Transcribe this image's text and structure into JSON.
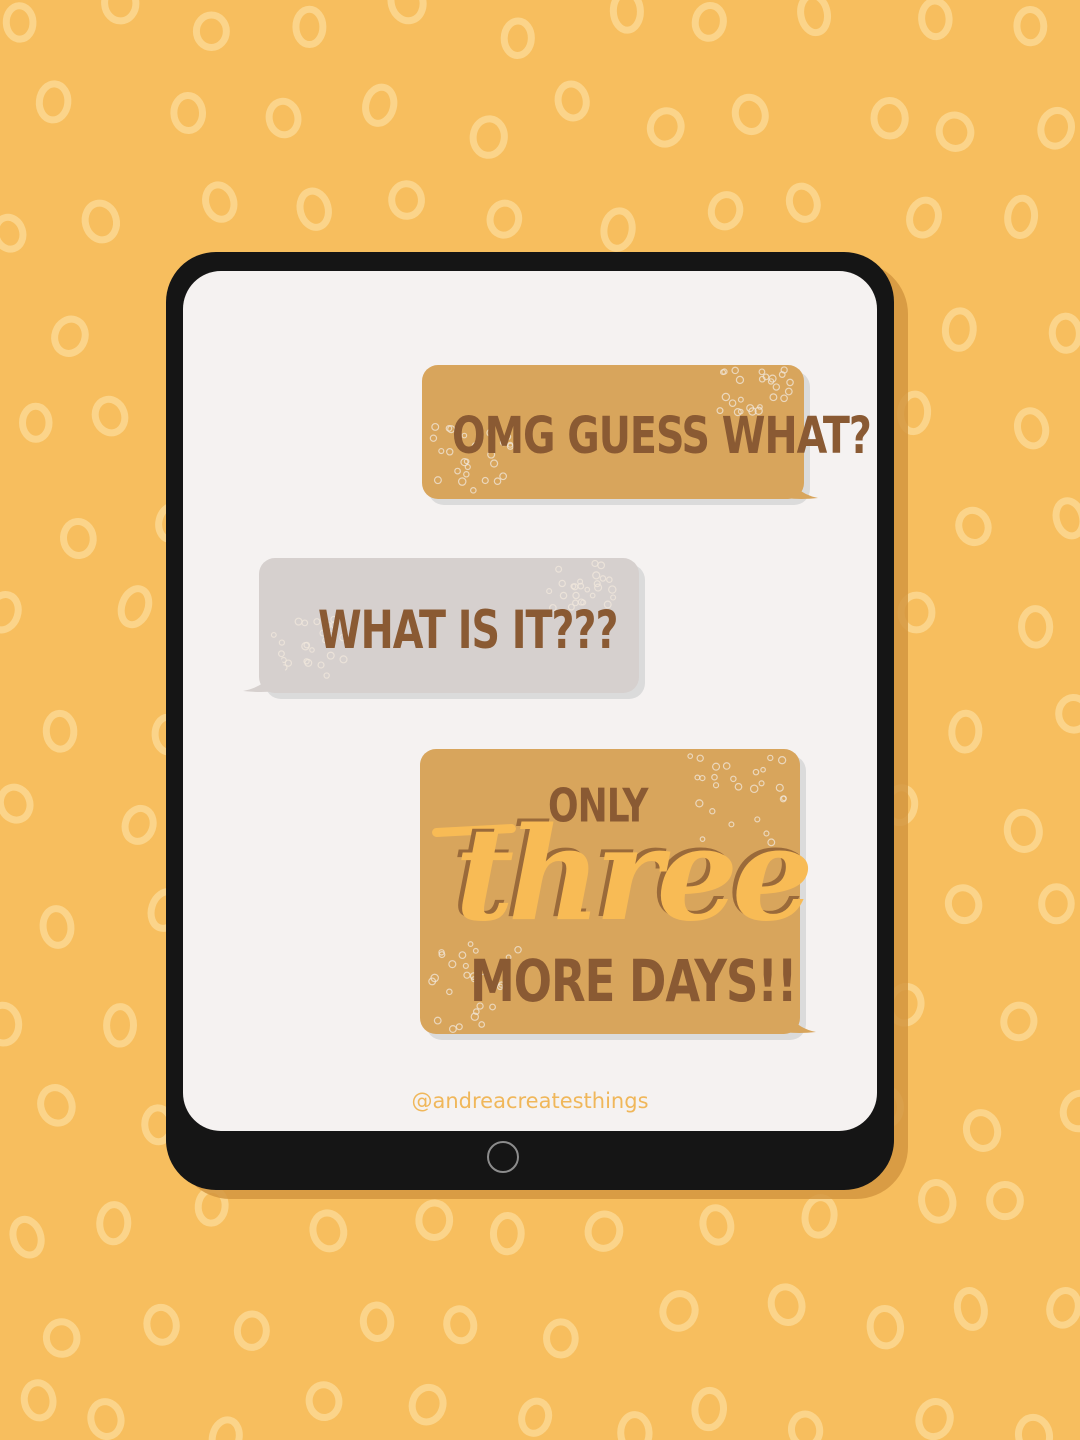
{
  "messages": [
    {
      "sender": "me",
      "text": "OMG GUESS WHAT?"
    },
    {
      "sender": "them",
      "text": "WHAT IS IT???"
    },
    {
      "sender": "me",
      "lines": [
        "ONLY",
        "three",
        "MORE DAYS!!"
      ]
    }
  ],
  "watermark": "@andreacreatesthings",
  "colors": {
    "background": "#f7be5e",
    "background_dots": "#fbd48a",
    "tablet_frame": "#151515",
    "screen": "#f5f2f1",
    "sent_bubble": "#d8a55c",
    "received_bubble": "#d6d0ce",
    "message_text": "#8a5a33",
    "highlight_text": "#f8bb55"
  },
  "icons": {
    "home_button": "home-button-circle"
  }
}
